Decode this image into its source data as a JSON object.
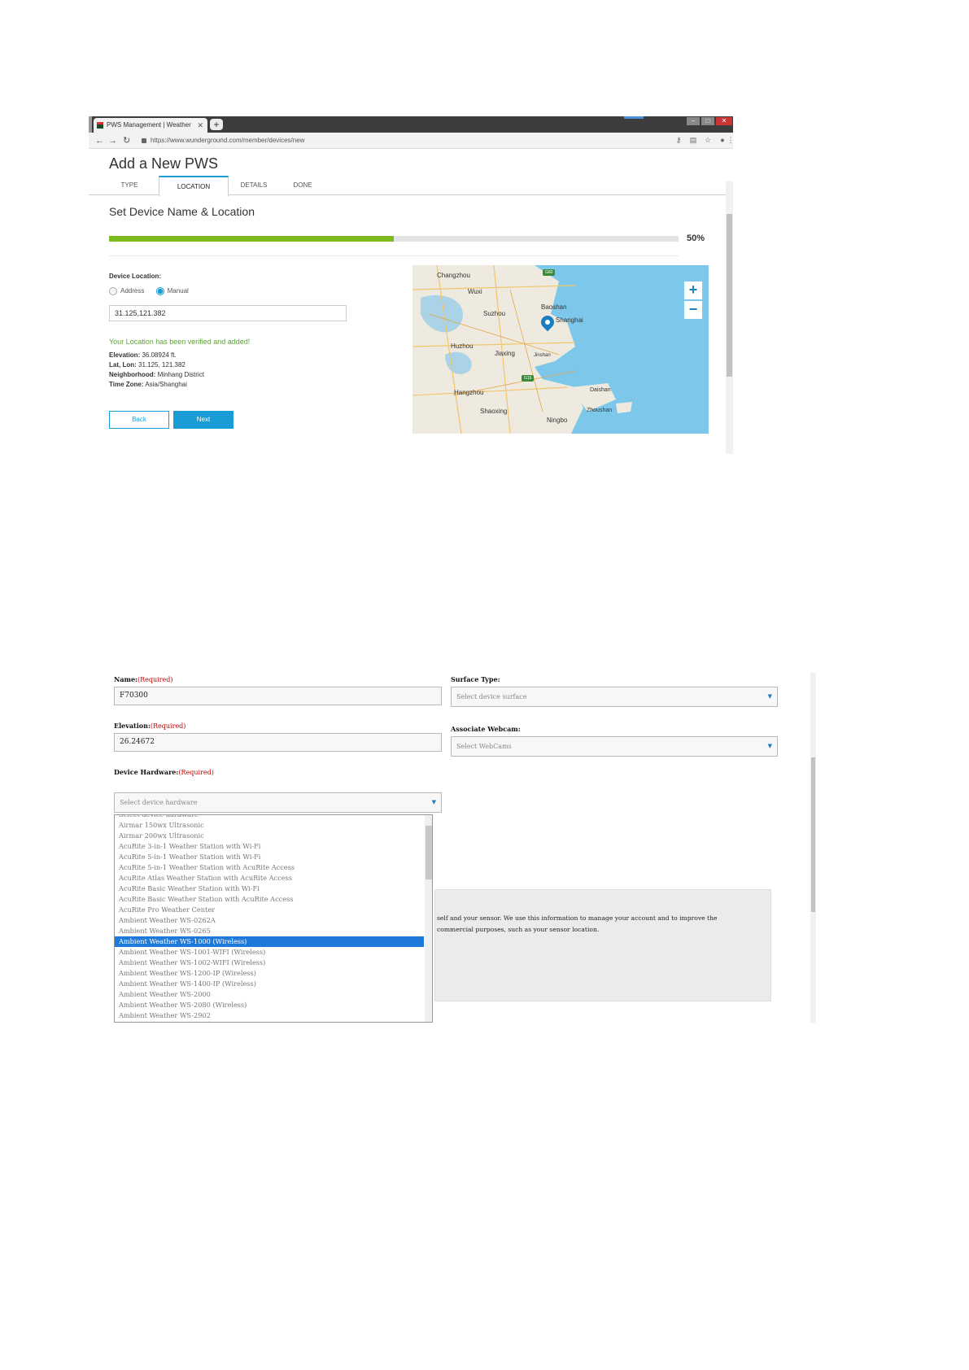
{
  "browser": {
    "tab_title": "PWS Management | Weather",
    "url": "https://www.wunderground.com/member/devices/new"
  },
  "page1": {
    "title": "Add a New PWS",
    "steps": [
      "TYPE",
      "LOCATION",
      "DETAILS",
      "DONE"
    ],
    "active_step": "LOCATION",
    "subtitle": "Set Device Name & Location",
    "progress_percent": 50,
    "progress_label": "50%",
    "progress_color": "#7cba1e",
    "device_location_label": "Device Location:",
    "radio_address": "Address",
    "radio_manual": "Manual",
    "selected_radio": "Manual",
    "coordinates_value": "31.125,121.382",
    "verified_message": "Your Location has been verified and added!",
    "elevation_label": "Elevation:",
    "elevation_value": "36.08924 ft.",
    "latlon_label": "Lat, Lon:",
    "latlon_value": "31.125, 121.382",
    "neighborhood_label": "Neighborhood:",
    "neighborhood_value": "Minhang District",
    "timezone_label": "Time Zone:",
    "timezone_value": "Asia/Shanghai",
    "back_label": "Back",
    "next_label": "Next",
    "accent_color": "#1a9cd6",
    "map": {
      "zoom_in": "+",
      "zoom_out": "−",
      "cities": [
        "Changzhou",
        "Wuxi",
        "Suzhou",
        "Baoshan",
        "Shanghai",
        "Huzhou",
        "Jiaxing",
        "Jinshan",
        "Hangzhou",
        "Shaoxing",
        "Ningbo",
        "Daishan",
        "Zhoushan"
      ],
      "highway_markers": [
        "G60",
        "G15"
      ]
    }
  },
  "page2": {
    "name_label": "Name:",
    "name_required": "(Required)",
    "name_value": "F70300",
    "elevation_label": "Elevation:",
    "elevation_required": "(Required)",
    "elevation_value": "26.24672",
    "hardware_label": "Device Hardware:",
    "hardware_required": "(Required)",
    "hardware_placeholder": "Select device hardware",
    "surface_label": "Surface Type:",
    "surface_placeholder": "Select device surface",
    "webcam_label": "Associate Webcam:",
    "webcam_placeholder": "Select WebCams",
    "hardware_options": [
      "Select device hardware",
      "Airmar 150wx Ultrasonic",
      "Airmar 200wx Ultrasonic",
      "AcuRite 3-in-1 Weather Station with Wi-Fi",
      "AcuRite 5-in-1 Weather Station with Wi-Fi",
      "AcuRite 5-in-1 Weather Station with AcuRite Access",
      "AcuRite Atlas Weather Station with AcuRite Access",
      "AcuRite Basic Weather Station with Wi-Fi",
      "AcuRite Basic Weather Station with AcuRite Access",
      "AcuRite Pro Weather Center",
      "Ambient Weather WS-0262A",
      "Ambient Weather WS-0265",
      "Ambient Weather WS-1000 (Wireless)",
      "Ambient Weather WS-1001-WIFI (Wireless)",
      "Ambient Weather WS-1002-WIFI (Wireless)",
      "Ambient Weather WS-1200-IP (Wireless)",
      "Ambient Weather WS-1400-IP (Wireless)",
      "Ambient Weather WS-2000",
      "Ambient Weather WS-2080 (Wireless)",
      "Ambient Weather WS-2902"
    ],
    "selected_hardware": "Ambient Weather WS-1000 (Wireless)",
    "info_line1": "self and your sensor. We use this information to manage your account and to improve the",
    "info_line2": "commercial purposes, such as your sensor location."
  }
}
